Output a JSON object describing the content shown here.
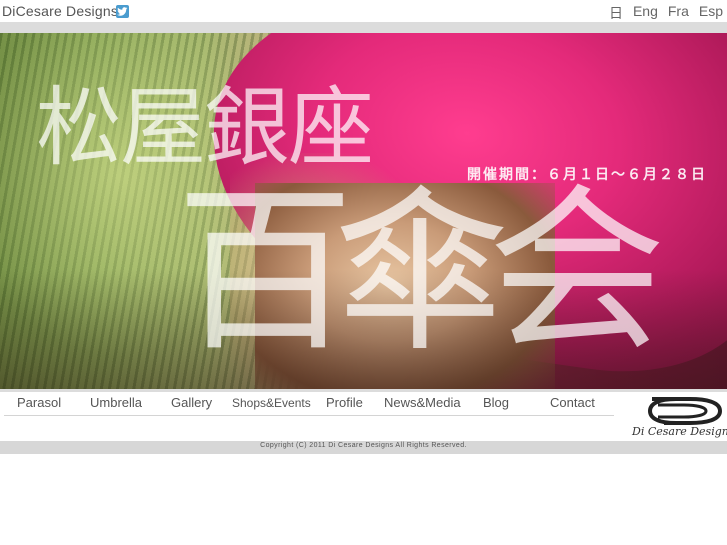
{
  "header": {
    "brand": "DiCesare Designs",
    "social_icon": "twitter-icon",
    "languages": [
      "日",
      "Eng",
      "Fra",
      "Esp"
    ]
  },
  "hero": {
    "store": "松屋銀座",
    "period": "開催期間：６月１日～６月２８日",
    "event": "百傘会"
  },
  "nav": {
    "items": [
      "Parasol",
      "Umbrella",
      "Gallery",
      "Shops&Events",
      "Profile",
      "News&Media",
      "Blog",
      "Contact"
    ]
  },
  "logo": {
    "text": "Di Cesare Designs"
  },
  "footer": {
    "copyright": "Copyright (C) 2011 Di Cesare Designs All Rights Reserved."
  },
  "colors": {
    "accent_pink": "#e42a7a",
    "grey_bar": "#dcdcdc",
    "text": "#555555"
  }
}
